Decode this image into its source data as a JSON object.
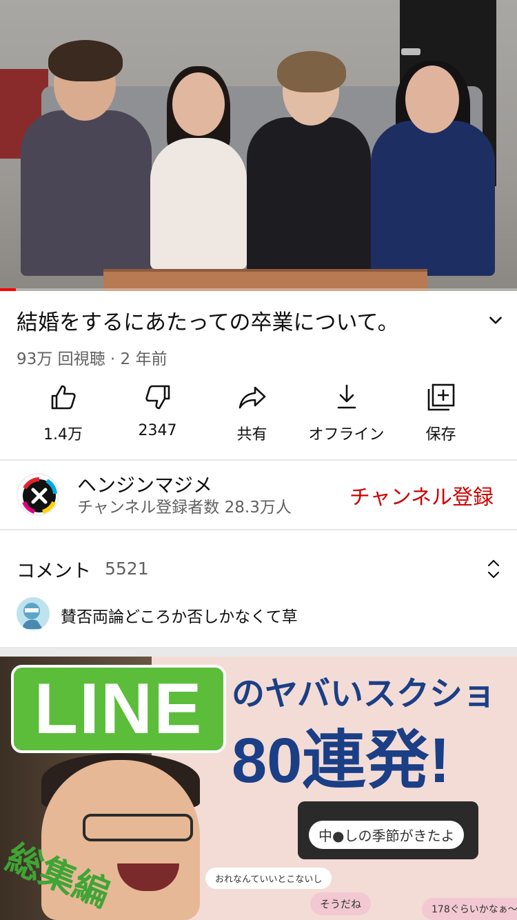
{
  "video": {
    "title": "結婚をするにあたっての卒業について。",
    "meta": "93万 回視聴 · 2 年前",
    "progress": 0.03
  },
  "actions": [
    {
      "label": "1.4万",
      "icon": "thumbs-up-icon"
    },
    {
      "label": "2347",
      "icon": "thumbs-down-icon"
    },
    {
      "label": "共有",
      "icon": "share-icon"
    },
    {
      "label": "オフライン",
      "icon": "download-icon"
    },
    {
      "label": "保存",
      "icon": "add-to-playlist-icon"
    }
  ],
  "channel": {
    "name": "ヘンジンマジメ",
    "subscribers": "チャンネル登録者数 28.3万人",
    "subscribe_label": "チャンネル登録"
  },
  "comments": {
    "heading": "コメント",
    "count": "5521",
    "top_comment": "賛否両論どころか否しかなくて草"
  },
  "next_video": {
    "badge": "LINE",
    "subtitle": "のヤバいスクショ",
    "headline": "80連発!",
    "chat": [
      "中●しの季節がきたよ",
      "おれなんていいとこないし",
      "そうだね",
      "178ぐらいかなぁ〜"
    ],
    "sticker": "総集編"
  },
  "colors": {
    "accent_red": "#cc0000",
    "progress_red": "#ff0000",
    "line_green": "#5bbd3a",
    "headline_blue": "#1b3f86"
  }
}
